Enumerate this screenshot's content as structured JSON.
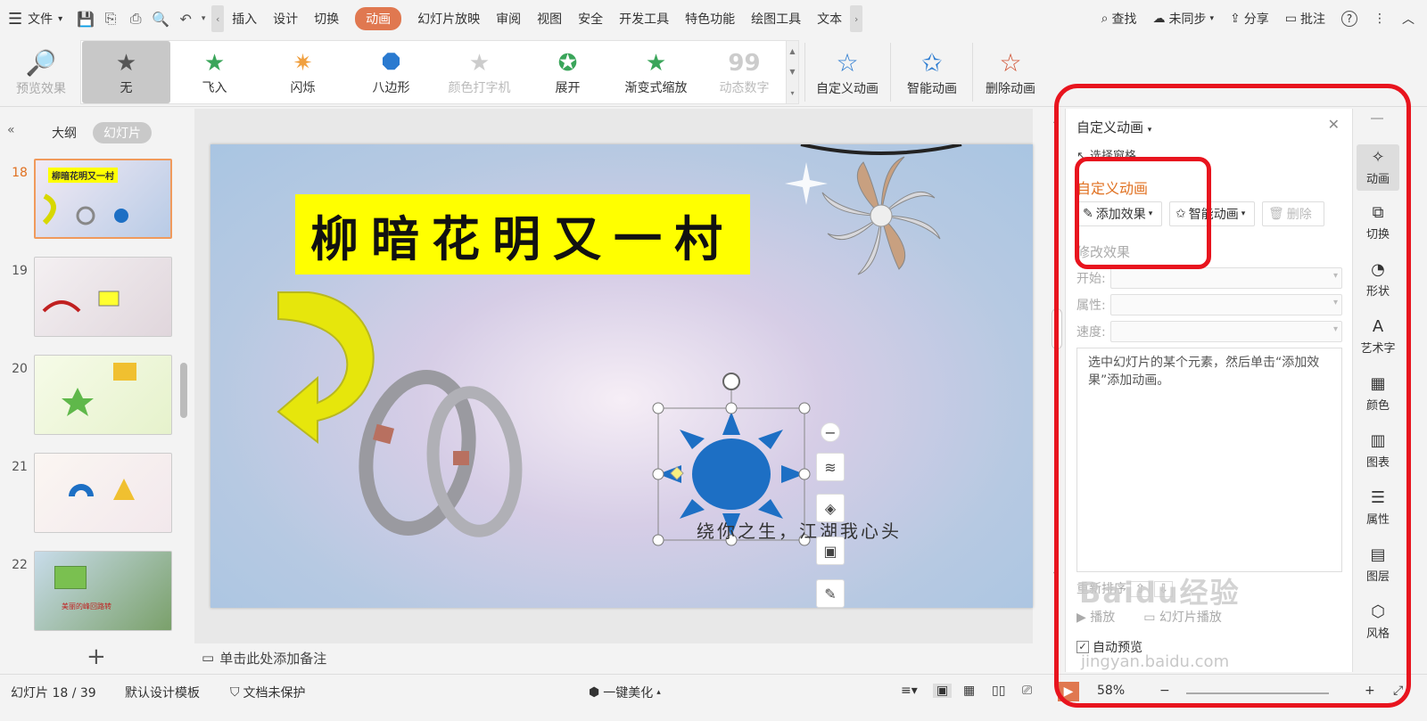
{
  "menubar": {
    "file_label": "文件",
    "tabs": [
      "插入",
      "设计",
      "切换",
      "动画",
      "幻灯片放映",
      "审阅",
      "视图",
      "安全",
      "开发工具",
      "特色功能",
      "绘图工具",
      "文本"
    ],
    "active_tab": "动画",
    "search_label": "查找",
    "sync_label": "未同步",
    "share_label": "分享",
    "comment_label": "批注"
  },
  "ribbon": {
    "preview_label": "预览效果",
    "effects": [
      {
        "label": "无",
        "icon": "star-icon"
      },
      {
        "label": "飞入",
        "icon": "star-fly-icon"
      },
      {
        "label": "闪烁",
        "icon": "star-flash-icon"
      },
      {
        "label": "八边形",
        "icon": "octagon-icon"
      },
      {
        "label": "颜色打字机",
        "icon": "star-typewriter-icon"
      },
      {
        "label": "展开",
        "icon": "star-expand-icon"
      },
      {
        "label": "渐变式缩放",
        "icon": "star-zoom-icon"
      },
      {
        "label": "动态数字",
        "icon": "number-99-icon"
      }
    ],
    "custom_anim_label": "自定义动画",
    "smart_anim_label": "智能动画",
    "delete_anim_label": "删除动画"
  },
  "left_panel": {
    "outline_tab": "大纲",
    "slides_tab": "幻灯片",
    "slide_numbers": [
      "18",
      "19",
      "20",
      "21",
      "22"
    ],
    "thumb18_title": "柳暗花明又一村",
    "thumb22_text": "美丽的峰回路转"
  },
  "slide": {
    "title": "柳暗花明又一村",
    "subtitle": "绕你之生，江湖我心头"
  },
  "notes_placeholder": "单击此处添加备注",
  "right_panel": {
    "header": "自定义动画",
    "select_pane": "选择窗格",
    "section_title": "自定义动画",
    "add_effect": "添加效果",
    "smart_anim": "智能动画",
    "delete": "删除",
    "modify_effect": "修改效果",
    "start_label": "开始:",
    "property_label": "属性:",
    "speed_label": "速度:",
    "hint": "选中幻灯片的某个元素，然后单击“添加效果”添加动画。",
    "reorder": "重新排序",
    "play": "播放",
    "slideshow": "幻灯片播放",
    "auto_preview": "自动预览"
  },
  "right_sidebar": [
    "动画",
    "切换",
    "形状",
    "艺术字",
    "颜色",
    "图表",
    "属性",
    "图层",
    "风格"
  ],
  "statusbar": {
    "slide_pos": "幻灯片 18 / 39",
    "template": "默认设计模板",
    "protect": "文档未保护",
    "beautify": "一键美化",
    "zoom": "58%"
  },
  "watermark": {
    "brand": "Baidu经验",
    "url": "jingyan.baidu.com"
  },
  "colors": {
    "accent": "#e07850",
    "highlight_red": "#e8141e",
    "title_yellow": "#ffff00",
    "sun_blue": "#1d6fc4"
  }
}
